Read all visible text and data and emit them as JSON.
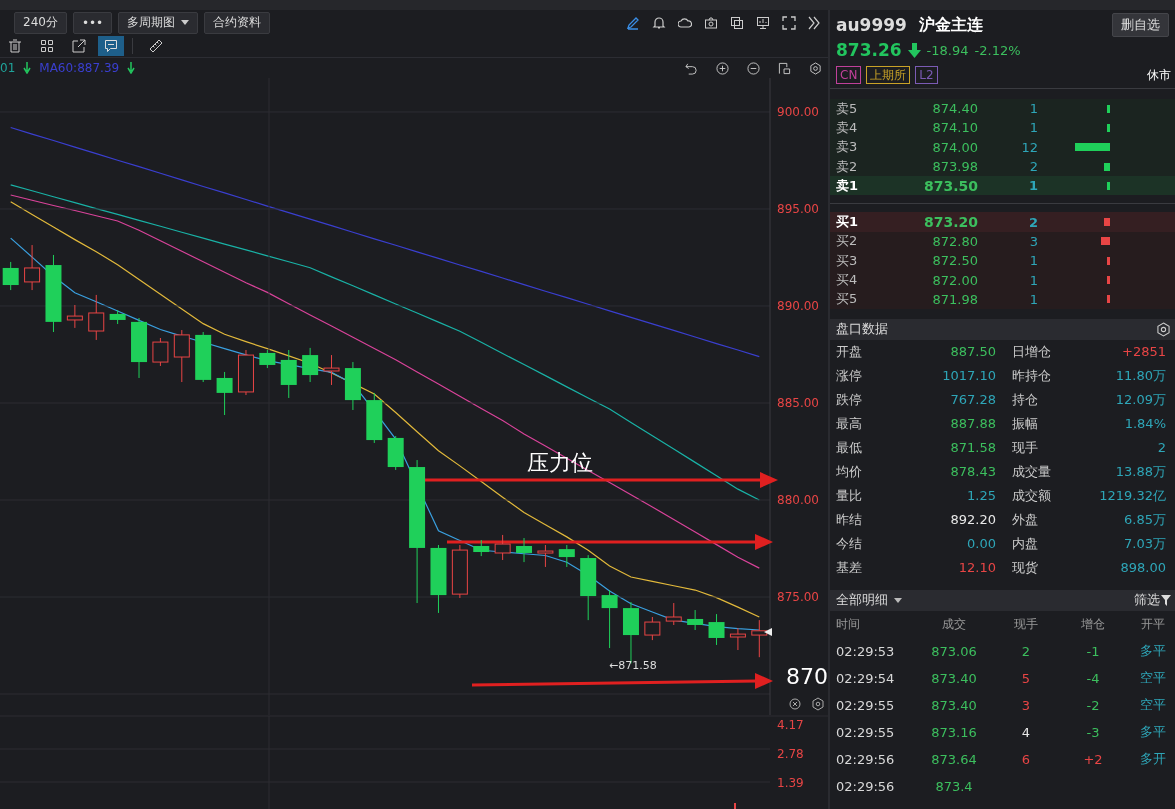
{
  "toolbar": {
    "buttons": [
      {
        "label": "240分",
        "kind": "plain"
      },
      {
        "label": "•••",
        "kind": "plain"
      },
      {
        "label": "多周期图",
        "kind": "dropdown"
      },
      {
        "label": "合约资料",
        "kind": "plain"
      }
    ]
  },
  "drawing_tools": [
    {
      "kind": "trash",
      "selected": false
    },
    {
      "kind": "grid",
      "selected": false
    },
    {
      "kind": "external",
      "selected": false
    },
    {
      "kind": "comment",
      "selected": true
    },
    {
      "kind": "ruler",
      "selected": false
    }
  ],
  "legend": [
    {
      "text": "01",
      "color": "#1fa39a",
      "arrow": true
    },
    {
      "text": "MA60:887.39",
      "color": "#3a3fd0",
      "arrow": true
    }
  ],
  "chart": {
    "chart_data": {
      "type": "candlestick",
      "categories": [
        null,
        null,
        null,
        null,
        null,
        null,
        null,
        null,
        null,
        null,
        null,
        null,
        null,
        null,
        null,
        null,
        null,
        null,
        null,
        null,
        null,
        null,
        null,
        null,
        null,
        null,
        null,
        null,
        null,
        null,
        null,
        null,
        null,
        null,
        null,
        null
      ],
      "ylim": [
        868.92,
        901.75
      ],
      "grid": true,
      "yticks": [
        {
          "value": 900,
          "label": "900.00"
        },
        {
          "value": 895,
          "label": "895.00"
        },
        {
          "value": 890,
          "label": "890.00"
        },
        {
          "value": 885,
          "label": "885.00"
        },
        {
          "value": 880,
          "label": "880.00"
        },
        {
          "value": 875,
          "label": "875.00"
        }
      ],
      "ohlc": [
        [
          891.96,
          892.27,
          890.82,
          891.08
        ],
        [
          891.24,
          893.14,
          890.82,
          891.96
        ],
        [
          892.11,
          892.63,
          888.66,
          889.18
        ],
        [
          889.28,
          890.05,
          888.87,
          889.48
        ],
        [
          888.71,
          890.57,
          888.25,
          889.64
        ],
        [
          889.59,
          889.79,
          889.07,
          889.28
        ],
        [
          889.18,
          889.38,
          886.29,
          887.11
        ],
        [
          887.11,
          888.35,
          886.91,
          888.14
        ],
        [
          887.37,
          888.76,
          886.08,
          888.51
        ],
        [
          888.51,
          888.66,
          886.08,
          886.19
        ],
        [
          886.29,
          886.6,
          884.38,
          885.52
        ],
        [
          885.57,
          887.73,
          885.41,
          887.47
        ],
        [
          887.58,
          887.73,
          886.8,
          886.96
        ],
        [
          887.22,
          887.73,
          885.26,
          885.93
        ],
        [
          887.47,
          887.84,
          886.08,
          886.44
        ],
        [
          886.65,
          887.47,
          885.93,
          886.8
        ],
        [
          886.8,
          887.11,
          884.64,
          885.15
        ],
        [
          885.15,
          885.52,
          882.94,
          883.09
        ],
        [
          883.2,
          883.3,
          881.55,
          881.7
        ],
        [
          881.7,
          882.06,
          874.69,
          877.53
        ],
        [
          877.53,
          877.68,
          874.18,
          875.1
        ],
        [
          875.15,
          877.68,
          874.95,
          877.42
        ],
        [
          877.63,
          877.94,
          877.11,
          877.32
        ],
        [
          877.27,
          878.2,
          876.91,
          877.73
        ],
        [
          877.63,
          878.04,
          876.8,
          877.27
        ],
        [
          877.27,
          877.68,
          876.55,
          877.37
        ],
        [
          877.47,
          877.68,
          876.55,
          877.06
        ],
        [
          877.01,
          877.16,
          873.81,
          875.05
        ],
        [
          875.1,
          875.36,
          872.37,
          874.43
        ],
        [
          874.43,
          874.74,
          871.58,
          873.04
        ],
        [
          873.04,
          873.97,
          872.78,
          873.71
        ],
        [
          873.76,
          874.69,
          873.56,
          873.97
        ],
        [
          873.87,
          874.33,
          873.3,
          873.56
        ],
        [
          873.71,
          874.12,
          872.53,
          872.89
        ],
        [
          872.94,
          873.4,
          872.27,
          873.09
        ],
        [
          873.04,
          873.81,
          871.9,
          873.26
        ]
      ]
    },
    "annotation": "压力位",
    "low_label": "←871.58",
    "price_tag": "870",
    "sub_labels": [
      "4.17",
      "2.78",
      "1.39"
    ]
  },
  "quote": {
    "code": "au9999",
    "name": "沪金主连",
    "watch_button": "删自选",
    "price": "873.26",
    "change": "-18.94",
    "change_pct": "-2.12%",
    "tags": [
      {
        "text": "CN",
        "color": "#c0409a"
      },
      {
        "text": "上期所",
        "color": "#c9a227"
      },
      {
        "text": "L2",
        "color": "#7b5bb5"
      }
    ],
    "status": "休市"
  },
  "order_book": [
    {
      "kind": "sell",
      "label": "卖5",
      "price": "874.40",
      "qty": "1",
      "best": false
    },
    {
      "kind": "sell",
      "label": "卖4",
      "price": "874.10",
      "qty": "1",
      "best": false
    },
    {
      "kind": "sell",
      "label": "卖3",
      "price": "874.00",
      "qty": "12",
      "best": false
    },
    {
      "kind": "sell",
      "label": "卖2",
      "price": "873.98",
      "qty": "2",
      "best": false
    },
    {
      "kind": "sell",
      "label": "卖1",
      "price": "873.50",
      "qty": "1",
      "best": true
    },
    {
      "kind": "buy",
      "label": "买1",
      "price": "873.20",
      "qty": "2",
      "best": true
    },
    {
      "kind": "buy",
      "label": "买2",
      "price": "872.80",
      "qty": "3",
      "best": false
    },
    {
      "kind": "buy",
      "label": "买3",
      "price": "872.50",
      "qty": "1",
      "best": false
    },
    {
      "kind": "buy",
      "label": "买4",
      "price": "872.00",
      "qty": "1",
      "best": false
    },
    {
      "kind": "buy",
      "label": "买5",
      "price": "871.98",
      "qty": "1",
      "best": false
    }
  ],
  "stats": {
    "title": "盘口数据",
    "items": [
      {
        "label": "开盘",
        "value": "887.50",
        "color": "#3cbf5e"
      },
      {
        "label": "日增仓",
        "value": "+2851",
        "color": "#e84545"
      },
      {
        "label": "涨停",
        "value": "1017.10",
        "color": "#2ea6b8"
      },
      {
        "label": "昨持仓",
        "value": "11.80万",
        "color": "#2ea6b8"
      },
      {
        "label": "跌停",
        "value": "767.28",
        "color": "#2ea6b8"
      },
      {
        "label": "持仓",
        "value": "12.09万",
        "color": "#2ea6b8"
      },
      {
        "label": "最高",
        "value": "887.88",
        "color": "#3cbf5e"
      },
      {
        "label": "振幅",
        "value": "1.84%",
        "color": "#2ea6b8"
      },
      {
        "label": "最低",
        "value": "871.58",
        "color": "#3cbf5e"
      },
      {
        "label": "现手",
        "value": "2",
        "color": "#2ea6b8"
      },
      {
        "label": "均价",
        "value": "878.43",
        "color": "#3cbf5e"
      },
      {
        "label": "成交量",
        "value": "13.88万",
        "color": "#2ea6b8"
      },
      {
        "label": "量比",
        "value": "1.25",
        "color": "#2ea6b8"
      },
      {
        "label": "成交额",
        "value": "1219.32亿",
        "color": "#2ea6b8"
      },
      {
        "label": "昨结",
        "value": "892.20",
        "color": "#e8e8e8"
      },
      {
        "label": "外盘",
        "value": "6.85万",
        "color": "#2ea6b8"
      },
      {
        "label": "今结",
        "value": "0.00",
        "color": "#2ea6b8"
      },
      {
        "label": "内盘",
        "value": "7.03万",
        "color": "#2ea6b8"
      },
      {
        "label": "基差",
        "value": "12.10",
        "color": "#e84545"
      },
      {
        "label": "现货",
        "value": "898.00",
        "color": "#2ea6b8"
      }
    ]
  },
  "trades": {
    "title": "全部明细",
    "filter": "筛选",
    "columns": [
      "时间",
      "成交",
      "现手",
      "增仓",
      "开平"
    ],
    "rows": [
      {
        "cells": [
          {
            "text": "02:29:53"
          },
          {
            "text": "873.06"
          },
          {
            "text": "2",
            "color": "#3cbf5e"
          },
          {
            "text": "-1",
            "color": "#3cbf5e"
          },
          {
            "text": "多平"
          }
        ]
      },
      {
        "cells": [
          {
            "text": "02:29:54"
          },
          {
            "text": "873.40"
          },
          {
            "text": "5",
            "color": "#e84545"
          },
          {
            "text": "-4",
            "color": "#3cbf5e"
          },
          {
            "text": "空平"
          }
        ]
      },
      {
        "cells": [
          {
            "text": "02:29:55"
          },
          {
            "text": "873.40"
          },
          {
            "text": "3",
            "color": "#e84545"
          },
          {
            "text": "-2",
            "color": "#3cbf5e"
          },
          {
            "text": "空平"
          }
        ]
      },
      {
        "cells": [
          {
            "text": "02:29:55"
          },
          {
            "text": "873.16"
          },
          {
            "text": "4",
            "color": "#e8e8e8"
          },
          {
            "text": "-3",
            "color": "#3cbf5e"
          },
          {
            "text": "多平"
          }
        ]
      },
      {
        "cells": [
          {
            "text": "02:29:56"
          },
          {
            "text": "873.64"
          },
          {
            "text": "6",
            "color": "#e84545"
          },
          {
            "text": "+2",
            "color": "#e84545"
          },
          {
            "text": "多开"
          }
        ]
      },
      {
        "cells": [
          {
            "text": "02:29:56"
          },
          {
            "text": "873.4"
          }
        ]
      }
    ]
  }
}
